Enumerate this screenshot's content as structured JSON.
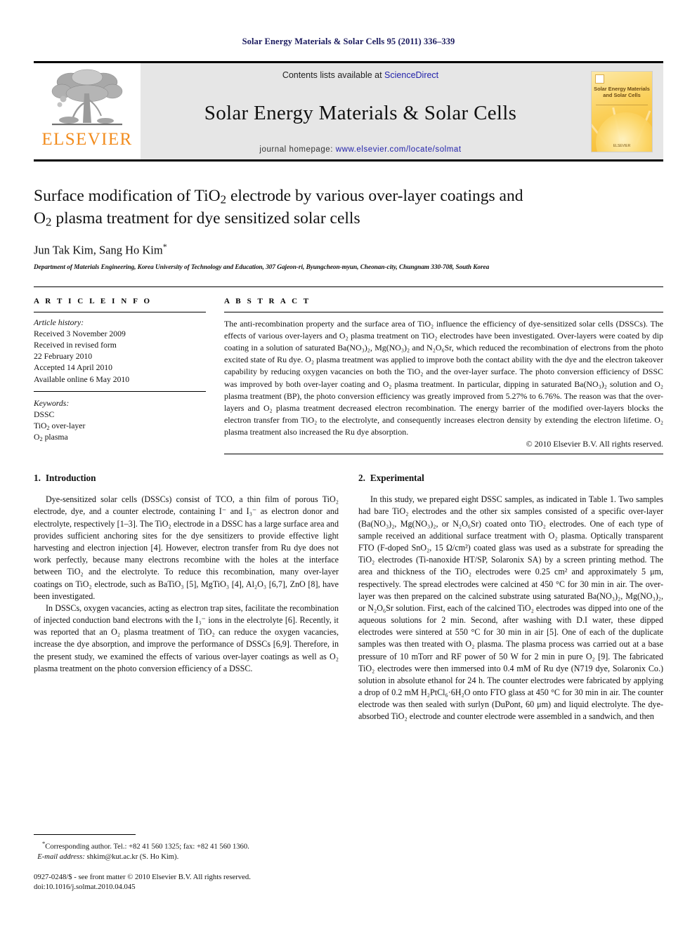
{
  "running_head": "Solar Energy Materials & Solar Cells 95 (2011) 336–339",
  "masthead": {
    "publisher": "ELSEVIER",
    "contents_prefix": "Contents lists available at ",
    "contents_link": "ScienceDirect",
    "journal_title": "Solar Energy Materials & Solar Cells",
    "homepage_prefix": "journal homepage: ",
    "homepage_url": "www.elsevier.com/locate/solmat",
    "cover_title_line1": "Solar Energy Materials",
    "cover_title_line2": "and Solar Cells",
    "cover_footer": "ELSEVIER",
    "link_color": "#2222aa",
    "brand_color": "#F28C1E"
  },
  "article": {
    "title_line1_a": "Surface modification of TiO",
    "title_line1_sub": "2",
    "title_line1_b": " electrode by various over-layer coatings and",
    "title_line2_a": "O",
    "title_line2_sub": "2",
    "title_line2_b": " plasma treatment for dye sensitized solar cells",
    "authors": "Jun Tak Kim, Sang Ho Kim",
    "affiliation": "Department of Materials Engineering, Korea University of Technology and Education, 307 Gajeon-ri, Byungcheon-myun, Cheonan-city, Chungnam 330-708, South Korea"
  },
  "article_info": {
    "heading": "A R T I C L E   I N F O",
    "history_label": "Article history:",
    "history": [
      "Received 3 November 2009",
      "Received in revised form",
      "22 February 2010",
      "Accepted 14 April 2010",
      "Available online 6 May 2010"
    ],
    "keywords_label": "Keywords:",
    "keywords": [
      "DSSC",
      "TiO2 over-layer",
      "O2 plasma"
    ]
  },
  "abstract": {
    "heading": "A B S T R A C T",
    "text": "The anti-recombination property and the surface area of TiO₂ influence the efficiency of dye-sensitized solar cells (DSSCs). The effects of various over-layers and O₂ plasma treatment on TiO₂ electrodes have been investigated. Over-layers were coated by dip coating in a solution of saturated Ba(NO₃)₂, Mg(NO₃)₂ and N₂O₆Sr, which reduced the recombination of electrons from the photo excited state of Ru dye. O₂ plasma treatment was applied to improve both the contact ability with the dye and the electron takeover capability by reducing oxygen vacancies on both the TiO₂ and the over-layer surface. The photo conversion efficiency of DSSC was improved by both over-layer coating and O₂ plasma treatment. In particular, dipping in saturated Ba(NO₃)₂ solution and O₂ plasma treatment (BP), the photo conversion efficiency was greatly improved from 5.27% to 6.76%. The reason was that the over-layers and O₂ plasma treatment decreased electron recombination. The energy barrier of the modified over-layers blocks the electron transfer from TiO₂ to the electrolyte, and consequently increases electron density by extending the electron lifetime. O₂ plasma treatment also increased the Ru dye absorption.",
    "copyright": "© 2010 Elsevier B.V. All rights reserved."
  },
  "sections": {
    "intro": {
      "number": "1.",
      "title": "Introduction",
      "paragraph1": "Dye-sensitized solar cells (DSSCs) consist of TCO, a thin film of porous TiO₂ electrode, dye, and a counter electrode, containing I⁻ and I₃⁻ as electron donor and electrolyte, respectively [1–3]. The TiO₂ electrode in a DSSC has a large surface area and provides sufficient anchoring sites for the dye sensitizers to provide effective light harvesting and electron injection [4]. However, electron transfer from Ru dye does not work perfectly, because many electrons recombine with the holes at the interface between TiO₂ and the electrolyte. To reduce this recombination, many over-layer coatings on TiO₂ electrode, such as BaTiO₃ [5], MgTiO₃ [4], Al₂O₃ [6,7], ZnO [8], have been investigated.",
      "paragraph2": "In DSSCs, oxygen vacancies, acting as electron trap sites, facilitate the recombination of injected conduction band electrons with the I₃⁻ ions in the electrolyte [6]. Recently, it was reported that an O₂ plasma treatment of TiO₂ can reduce the oxygen vacancies, increase the dye absorption, and improve the performance of DSSCs [6,9]. Therefore, in the present study, we examined the effects of various over-layer coatings as well as O₂ plasma treatment on the photo conversion efficiency of a DSSC."
    },
    "experimental": {
      "number": "2.",
      "title": "Experimental",
      "paragraph1": "In this study, we prepared eight DSSC samples, as indicated in Table 1. Two samples had bare TiO₂ electrodes and the other six samples consisted of a specific over-layer (Ba(NO₃)₂, Mg(NO₃)₂, or N₂O₆Sr) coated onto TiO₂ electrodes. One of each type of sample received an additional surface treatment with O₂ plasma. Optically transparent FTO (F-doped SnO₂, 15 Ω/cm²) coated glass was used as a substrate for spreading the TiO₂ electrodes (Ti-nanoxide HT/SP, Solaronix SA) by a screen printing method. The area and thickness of the TiO₂ electrodes were 0.25 cm² and approximately 5 μm, respectively. The spread electrodes were calcined at 450 °C for 30 min in air. The over-layer was then prepared on the calcined substrate using saturated Ba(NO₃)₂, Mg(NO₃)₂, or N₂O₆Sr solution. First, each of the calcined TiO₂ electrodes was dipped into one of the aqueous solutions for 2 min. Second, after washing with D.I water, these dipped electrodes were sintered at 550 °C for 30 min in air [5]. One of each of the duplicate samples was then treated with O₂ plasma. The plasma process was carried out at a base pressure of 10 mTorr and RF power of 50 W for 2 min in pure O₂ [9]. The fabricated TiO₂ electrodes were then immersed into 0.4 mM of Ru dye (N719 dye, Solaronix Co.) solution in absolute ethanol for 24 h. The counter electrodes were fabricated by applying a drop of 0.2 mM H₂PtCl₆·6H₂O onto FTO glass at 450 °C for 30 min in air. The counter electrode was then sealed with surlyn (DuPont, 60 μm) and liquid electrolyte. The dye-absorbed TiO₂ electrode and counter electrode were assembled in a sandwich, and then"
    }
  },
  "footnote": {
    "corresponding": "Corresponding author. Tel.: +82 41 560 1325; fax: +82 41 560 1360.",
    "email_label": "E-mail address:",
    "email": "shkim@kut.ac.kr (S. Ho Kim).",
    "issn_line": "0927-0248/$ - see front matter © 2010 Elsevier B.V. All rights reserved.",
    "doi_line": "doi:10.1016/j.solmat.2010.04.045"
  }
}
